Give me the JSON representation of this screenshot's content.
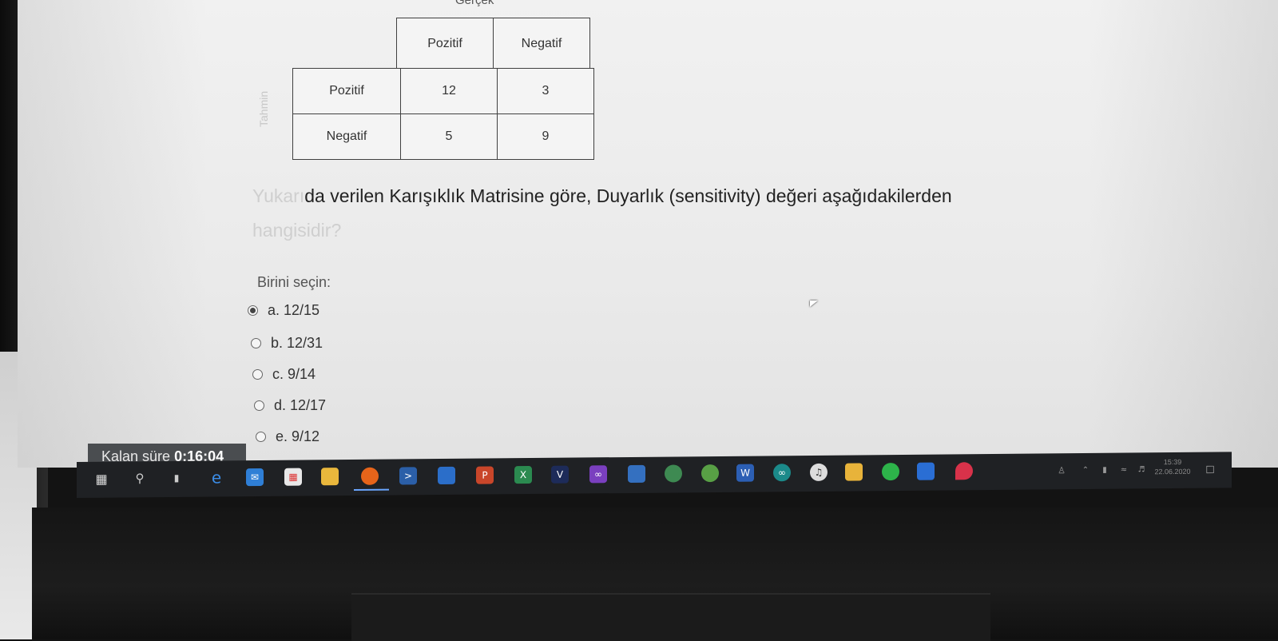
{
  "page": {
    "top_label": "Gerçek"
  },
  "matrix": {
    "side_label": "Tahmin",
    "columns": [
      "Pozitif",
      "Negatif"
    ],
    "rows": [
      {
        "label": "Pozitif",
        "values": [
          "12",
          "3"
        ]
      },
      {
        "label": "Negatif",
        "values": [
          "5",
          "9"
        ]
      }
    ]
  },
  "question": {
    "text_faded_1": "Yukarı",
    "text_1": "da verilen Karışıklık Matrisine göre, Duyarlık (sensitivity) değeri aşağıdakilerden",
    "text_faded_2": "hangisidir?"
  },
  "answer_prompt": "Birini seçin:",
  "options": [
    {
      "label": "a. 12/15",
      "selected": true
    },
    {
      "label": "b. 12/31",
      "selected": false
    },
    {
      "label": "c. 9/14",
      "selected": false
    },
    {
      "label": "d. 12/17",
      "selected": false
    },
    {
      "label": "e. 9/12",
      "selected": false
    }
  ],
  "timer": {
    "label": "Kalan süre",
    "value": "0:16:04"
  },
  "taskbar": {
    "icons": [
      "windows-start",
      "search",
      "task-view",
      "edge",
      "mail",
      "store",
      "file-explorer",
      "firefox",
      "powershell",
      "monitor",
      "powerpoint",
      "excel",
      "visual-basic",
      "visual-studio",
      "virtualbox",
      "android-studio",
      "anaconda",
      "word",
      "arduino",
      "itunes",
      "paint",
      "whatsapp",
      "app",
      "drop"
    ],
    "colors": {
      "taskbar": "#1f2124",
      "accent": "#6aa6ff"
    }
  },
  "tray": {
    "time": "15:39",
    "date": "22.06.2020"
  }
}
